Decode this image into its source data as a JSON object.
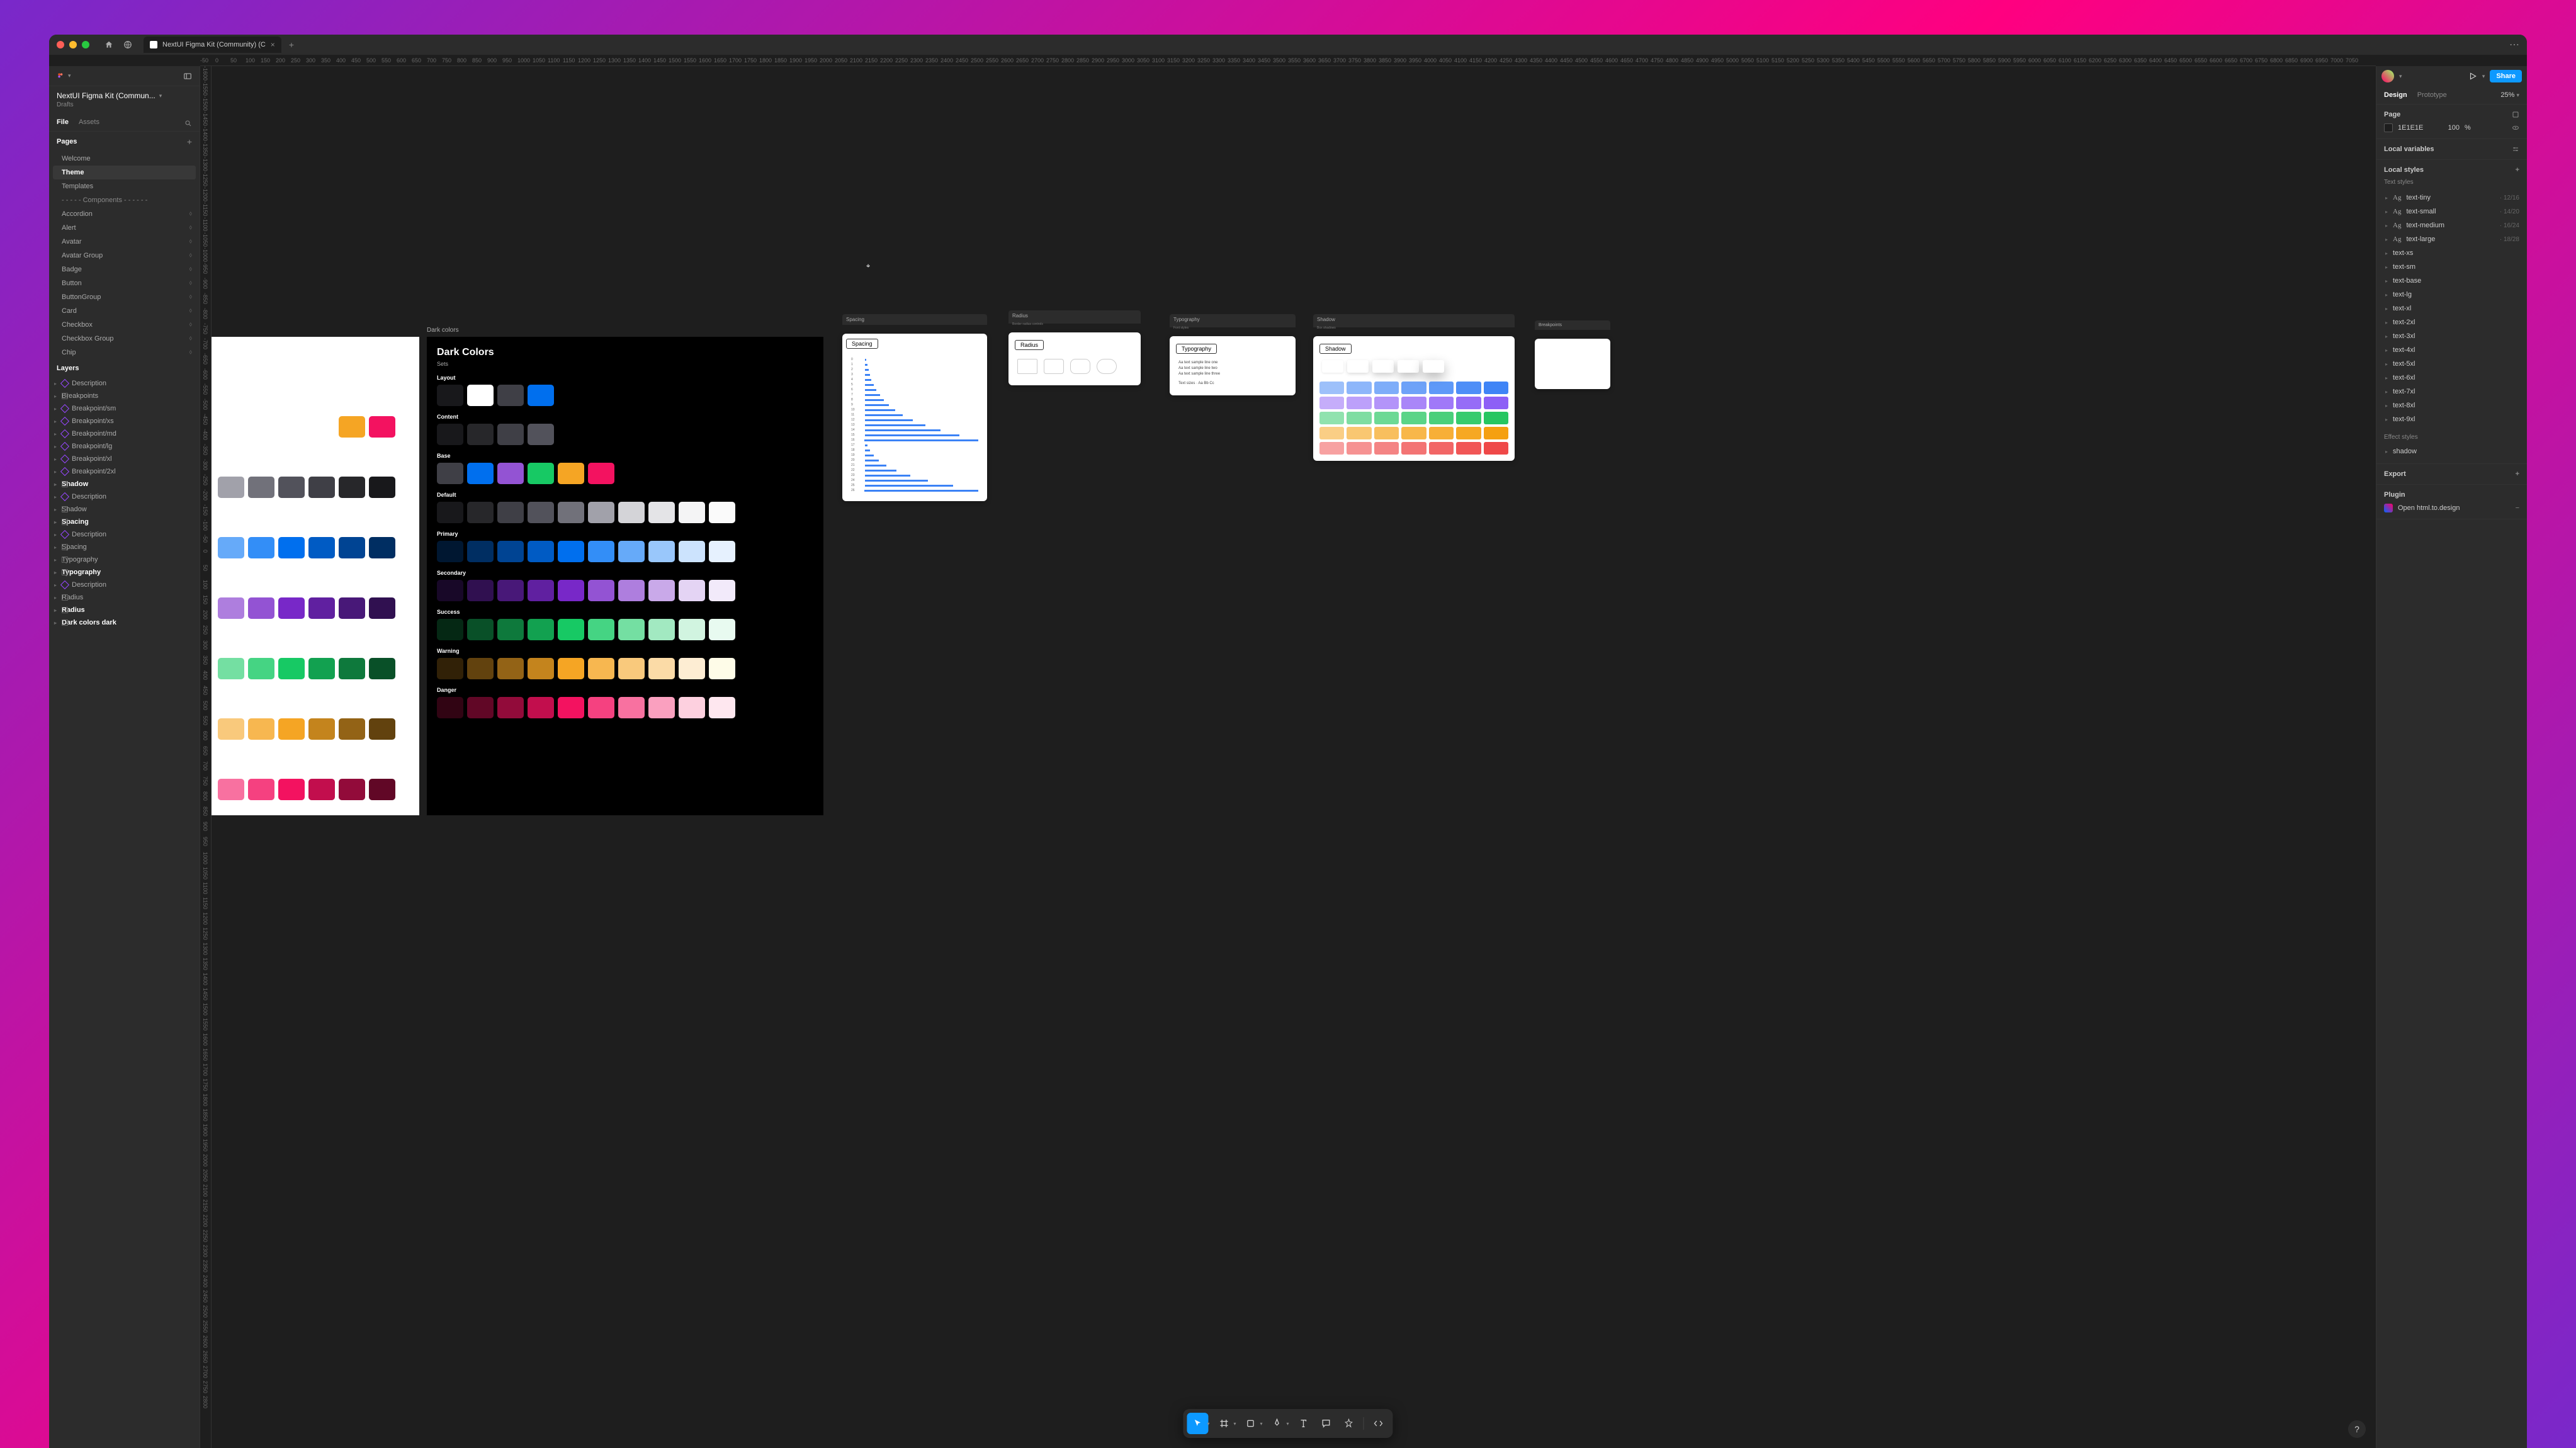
{
  "window": {
    "tab_title": "NextUI Figma Kit (Community) (C",
    "file_name": "NextUI Figma Kit (Commun...",
    "drafts": "Drafts"
  },
  "left_panel": {
    "tabs": {
      "file": "File",
      "assets": "Assets"
    },
    "pages_title": "Pages",
    "pages": [
      {
        "label": "Welcome"
      },
      {
        "label": "Theme",
        "selected": true
      },
      {
        "label": "Templates"
      },
      {
        "label": "- - - - -  Components - - - - - -",
        "divider": true
      },
      {
        "label": "Accordion",
        "comp": true
      },
      {
        "label": "Alert",
        "comp": true
      },
      {
        "label": "Avatar",
        "comp": true
      },
      {
        "label": "Avatar Group",
        "comp": true
      },
      {
        "label": "Badge",
        "comp": true
      },
      {
        "label": "Button",
        "comp": true
      },
      {
        "label": "ButtonGroup",
        "comp": true
      },
      {
        "label": "Card",
        "comp": true
      },
      {
        "label": "Checkbox",
        "comp": true
      },
      {
        "label": "Checkbox Group",
        "comp": true
      },
      {
        "label": "Chip",
        "comp": true
      }
    ],
    "layers_title": "Layers",
    "layers": [
      {
        "label": "Description",
        "icon": "comp"
      },
      {
        "label": "Breakpoints",
        "icon": "frame",
        "bold": false
      },
      {
        "label": "Breakpoint/sm",
        "icon": "comp"
      },
      {
        "label": "Breakpoint/xs",
        "icon": "comp"
      },
      {
        "label": "Breakpoint/md",
        "icon": "comp"
      },
      {
        "label": "Breakpoint/lg",
        "icon": "comp"
      },
      {
        "label": "Breakpoint/xl",
        "icon": "comp"
      },
      {
        "label": "Breakpoint/2xl",
        "icon": "comp"
      },
      {
        "label": "Shadow",
        "icon": "frame",
        "bold": true
      },
      {
        "label": "Description",
        "icon": "comp"
      },
      {
        "label": "Shadow",
        "icon": "frame"
      },
      {
        "label": "Spacing",
        "icon": "frame",
        "bold": true
      },
      {
        "label": "Description",
        "icon": "comp"
      },
      {
        "label": "Spacing",
        "icon": "frame"
      },
      {
        "label": "Typography",
        "icon": "frame"
      },
      {
        "label": "Typography",
        "icon": "frame",
        "bold": true
      },
      {
        "label": "Description",
        "icon": "comp"
      },
      {
        "label": "Radius",
        "icon": "frame"
      },
      {
        "label": "Radius",
        "icon": "frame",
        "bold": true
      },
      {
        "label": "Dark colors   dark",
        "icon": "frame",
        "bold": true
      }
    ]
  },
  "ruler_h": [
    -50,
    0,
    50,
    100,
    150,
    200,
    250,
    300,
    350,
    400,
    450,
    500,
    550,
    600,
    650,
    700,
    750,
    800,
    850,
    900,
    950,
    1000,
    1050,
    1100,
    1150,
    1200,
    1250,
    1300,
    1350,
    1400,
    1450,
    1500,
    1550,
    1600,
    1650,
    1700,
    1750,
    1800,
    1850,
    1900,
    1950,
    2000,
    2050,
    2100,
    2150,
    2200,
    2250,
    2300,
    2350,
    2400,
    2450,
    2500,
    2550,
    2600,
    2650,
    2700,
    2750,
    2800,
    2850,
    2900,
    2950,
    3000,
    3050,
    3100,
    3150,
    3200,
    3250,
    3300,
    3350,
    3400,
    3450,
    3500,
    3550,
    3600,
    3650,
    3700,
    3750,
    3800,
    3850,
    3900,
    3950,
    4000,
    4050,
    4100,
    4150,
    4200,
    4250,
    4300,
    4350,
    4400,
    4450,
    4500,
    4550,
    4600,
    4650,
    4700,
    4750,
    4800,
    4850,
    4900,
    4950,
    5000,
    5050,
    5100,
    5150,
    5200,
    5250,
    5300,
    5350,
    5400,
    5450,
    5500,
    5550,
    5600,
    5650,
    5700,
    5750,
    5800,
    5850,
    5900,
    5950,
    6000,
    6050,
    6100,
    6150,
    6200,
    6250,
    6300,
    6350,
    6400,
    6450,
    6500,
    6550,
    6600,
    6650,
    6700,
    6750,
    6800,
    6850,
    6900,
    6950,
    7000,
    7050
  ],
  "ruler_v": [
    -1600,
    -1550,
    -1500,
    -1450,
    -1400,
    -1350,
    -1300,
    -1250,
    -1200,
    -1150,
    -1100,
    -1050,
    -1000,
    -950,
    -900,
    -850,
    -800,
    -750,
    -700,
    -650,
    -600,
    -550,
    -500,
    -450,
    -400,
    -350,
    -300,
    -250,
    -200,
    -150,
    -100,
    -50,
    0,
    50,
    100,
    150,
    200,
    250,
    300,
    350,
    400,
    450,
    500,
    550,
    600,
    650,
    700,
    750,
    800,
    850,
    900,
    950,
    1000,
    1050,
    1100,
    1150,
    1200,
    1250,
    1300,
    1350,
    1400,
    1450,
    1500,
    1550,
    1600,
    1650,
    1700,
    1750,
    1800,
    1850,
    1900,
    1950,
    2000,
    2050,
    2100,
    2150,
    2200,
    2250,
    2300,
    2350,
    2400,
    2450,
    2500,
    2550,
    2600,
    2650,
    2700,
    2750,
    2800
  ],
  "frames": {
    "dark_colors": {
      "label": "Dark colors",
      "title": "Dark Colors",
      "sets": "Sets",
      "groups": {
        "layout": "Layout",
        "content": "Content",
        "base": "Base",
        "default": "Default",
        "primary": "Primary",
        "secondary": "Secondary",
        "success": "Success",
        "warning": "Warning",
        "danger": "Danger"
      }
    },
    "spacing": {
      "header": "Spacing",
      "title": "Spacing"
    },
    "radius": {
      "header": "Radius",
      "title": "Radius"
    },
    "typography": {
      "header": "Typography",
      "title": "Typography"
    },
    "shadow": {
      "header": "Shadow",
      "title": "Shadow"
    },
    "breakpoints": {
      "header": "Breakpoints"
    }
  },
  "colors": {
    "layout": [
      "#18181b",
      "#ffffff",
      "#3f3f46",
      "#006FEE"
    ],
    "content": [
      "#18181b",
      "#27272a",
      "#3f3f46",
      "#52525b"
    ],
    "base": [
      "#3f3f46",
      "#006FEE",
      "#9353d3",
      "#17c964",
      "#f5a524",
      "#f31260"
    ],
    "default": [
      "#18181b",
      "#27272a",
      "#3f3f46",
      "#52525b",
      "#71717a",
      "#a1a1aa",
      "#d4d4d8",
      "#e4e4e7",
      "#f4f4f5",
      "#fafafa"
    ],
    "primary": [
      "#001731",
      "#002e62",
      "#004493",
      "#005bc4",
      "#006FEE",
      "#338ef7",
      "#66aaf9",
      "#99c7fb",
      "#cce3fd",
      "#e6f1fe"
    ],
    "secondary": [
      "#180828",
      "#301050",
      "#481878",
      "#6020a0",
      "#7828c8",
      "#9353d3",
      "#ae7ede",
      "#c9a9e9",
      "#e4d4f4",
      "#f2eafa"
    ],
    "success": [
      "#052814",
      "#095028",
      "#0e793c",
      "#12a150",
      "#17c964",
      "#45d483",
      "#74dfa2",
      "#a2e9c1",
      "#d1f4e0",
      "#e8faf0"
    ],
    "warning": [
      "#312107",
      "#62420e",
      "#936316",
      "#c4841d",
      "#f5a524",
      "#f7b750",
      "#f9c97c",
      "#fbdba7",
      "#fdedd3",
      "#fefce8"
    ],
    "danger": [
      "#310413",
      "#610726",
      "#920b3a",
      "#c20e4d",
      "#f31260",
      "#f54180",
      "#f871a0",
      "#faa0bf",
      "#fdd0df",
      "#fee7ef"
    ],
    "light_rows": [
      [
        "#f5a524",
        "#f31260"
      ],
      [
        "#a1a1aa",
        "#71717a",
        "#52525b",
        "#3f3f46",
        "#27272a",
        "#18181b"
      ],
      [
        "#66aaf9",
        "#338ef7",
        "#006FEE",
        "#005bc4",
        "#004493",
        "#002e62"
      ],
      [
        "#ae7ede",
        "#9353d3",
        "#7828c8",
        "#6020a0",
        "#481878",
        "#301050"
      ],
      [
        "#74dfa2",
        "#45d483",
        "#17c964",
        "#12a150",
        "#0e793c",
        "#095028"
      ],
      [
        "#f9c97c",
        "#f7b750",
        "#f5a524",
        "#c4841d",
        "#936316",
        "#62420e"
      ],
      [
        "#f871a0",
        "#f54180",
        "#f31260",
        "#c20e4d",
        "#920b3a",
        "#610726"
      ]
    ],
    "shadow_grid": [
      "#3b82f6",
      "#8b5cf6",
      "#22c55e",
      "#f59e0b",
      "#ef4444"
    ]
  },
  "right_panel": {
    "share": "Share",
    "tabs": {
      "design": "Design",
      "prototype": "Prototype"
    },
    "zoom": "25%",
    "page": "Page",
    "page_color": "1E1E1E",
    "page_opacity": "100",
    "page_pct": "%",
    "local_variables": "Local variables",
    "local_styles": "Local styles",
    "text_styles": "Text styles",
    "text_items": [
      {
        "name": "text-tiny",
        "meta": "12/16"
      },
      {
        "name": "text-small",
        "meta": "14/20"
      },
      {
        "name": "text-medium",
        "meta": "16/24"
      },
      {
        "name": "text-large",
        "meta": "18/28"
      },
      {
        "name": "text-xs"
      },
      {
        "name": "text-sm"
      },
      {
        "name": "text-base"
      },
      {
        "name": "text-lg"
      },
      {
        "name": "text-xl"
      },
      {
        "name": "text-2xl"
      },
      {
        "name": "text-3xl"
      },
      {
        "name": "text-4xl"
      },
      {
        "name": "text-5xl"
      },
      {
        "name": "text-6xl"
      },
      {
        "name": "text-7xl"
      },
      {
        "name": "text-8xl"
      },
      {
        "name": "text-9xl"
      }
    ],
    "effect_styles": "Effect styles",
    "effect_items": [
      {
        "name": "shadow"
      }
    ],
    "export": "Export",
    "plugin": "Plugin",
    "plugin_name": "Open html.to.design"
  }
}
